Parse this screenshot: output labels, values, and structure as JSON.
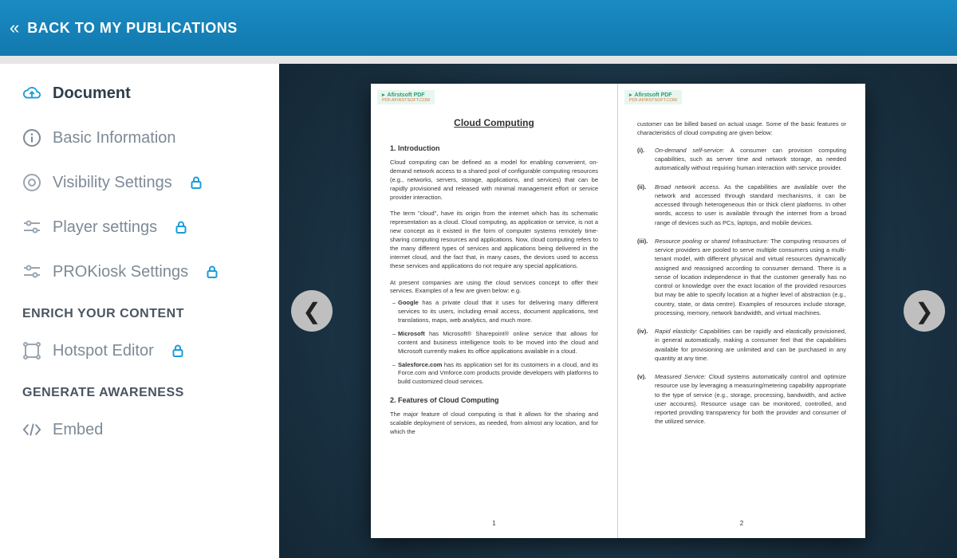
{
  "topbar": {
    "back_label": "BACK TO MY PUBLICATIONS"
  },
  "sidebar": {
    "items": [
      {
        "label": "Document",
        "locked": false,
        "active": true,
        "icon": "cloud-upload-icon"
      },
      {
        "label": "Basic Information",
        "locked": false,
        "active": false,
        "icon": "info-icon"
      },
      {
        "label": "Visibility Settings",
        "locked": true,
        "active": false,
        "icon": "radio-icon"
      },
      {
        "label": "Player settings",
        "locked": true,
        "active": false,
        "icon": "sliders-icon"
      },
      {
        "label": "PROKiosk Settings",
        "locked": true,
        "active": false,
        "icon": "sliders-icon"
      }
    ],
    "section_enrich": "ENRICH YOUR CONTENT",
    "enrich_items": [
      {
        "label": "Hotspot Editor",
        "locked": true,
        "icon": "hotspot-icon"
      }
    ],
    "section_awareness": "GENERATE AWARENESS",
    "awareness_items": [
      {
        "label": "Embed",
        "locked": false,
        "icon": "code-icon"
      }
    ]
  },
  "viewer": {
    "pdf_badge_title": "Afirstsoft PDF",
    "pdf_badge_sub": "PDF.AFIRSTSOFT.COM",
    "page_left": {
      "title": "Cloud Computing",
      "h_intro": "1. Introduction",
      "p1": "Cloud computing can be defined as a model for enabling convenient, on-demand network access to a shared pool of configurable computing resources (e.g., networks, servers, storage, applications, and services) that can be rapidly provisioned and released with minimal management effort or service provider interaction.",
      "p2": "The term \"cloud\", have its origin from the internet which has its schematic representation as a cloud. Cloud computing, as application or service, is not a new concept as it existed in the form of computer systems remotely time-sharing computing resources and applications. Now, cloud computing refers to the many different types of services and applications being delivered in the internet cloud, and the fact that, in many cases, the devices used to access these services and applications do not require any special applications.",
      "p3": "At present companies are using the cloud services concept to offer their services. Examples of a few are given below: e.g.",
      "b1_bold": "Google",
      "b1_text": " has a private cloud that it uses for delivering many different services to its users, including email access, document applications, text translations, maps, web analytics, and much more.",
      "b2_bold": "Microsoft",
      "b2_text": " has Microsoft® Sharepoint® online service that allows for content and business intelligence tools to be moved into the cloud and Microsoft currently makes its office applications available in a cloud.",
      "b3_bold": "Salesforce.com",
      "b3_text": " has its application set for its customers in a cloud, and its Force.com and Vmforce.com products provide developers with platforms to build customized cloud services.",
      "h_features": "2. Features of Cloud Computing",
      "p4": "The major feature of cloud computing is that it allows for the sharing and scalable deployment of services, as needed, from almost any location, and for which the",
      "page_num": "1"
    },
    "page_right": {
      "lead": "customer can be billed based on actual usage. Some of the basic features or characteristics of cloud computing are given below:",
      "i1_num": "(i).",
      "i1_it": "On-demand self-service:",
      "i1_t": " A consumer can provision computing capabilities, such as server time and network storage, as needed automatically without requiring human interaction with service provider.",
      "i2_num": "(ii).",
      "i2_it": "Broad network access.",
      "i2_t": " As the capabilities are available over the network and accessed through standard mechanisms, it can be accessed through heterogeneous thin or thick client platforms. In other words, access to user is available through the internet from a broad range of devices such as PCs, laptops, and mobile devices.",
      "i3_num": "(iii).",
      "i3_it": "Resource pooling or shared Infrastructure:",
      "i3_t": " The computing resources of service providers are pooled to serve multiple consumers using a multi-tenant model, with different physical and virtual resources dynamically assigned and reassigned according to consumer demand. There is a sense of location independence in that the customer generally has no control or knowledge over the exact location of the provided resources but may be able to specify location at a higher level of abstraction (e.g., country, state, or data centre). Examples of resources include storage, processing, memory, network bandwidth, and virtual machines.",
      "i4_num": "(iv).",
      "i4_it": "Rapid elasticity:",
      "i4_t": " Capabilities can be rapidly and elastically provisioned, in general automatically, making a consumer feel that the capabilities available for provisioning are unlimited and can be purchased in any quantity at any time.",
      "i5_num": "(v).",
      "i5_it": "Measured Service:",
      "i5_t": " Cloud systems automatically control and optimize resource use by leveraging a measuring/metering capability appropriate to the type of service (e.g., storage, processing, bandwidth, and active user accounts). Resource usage can be monitored, controlled, and reported providing transparency for both the provider and consumer of the utilized service.",
      "page_num": "2"
    }
  }
}
